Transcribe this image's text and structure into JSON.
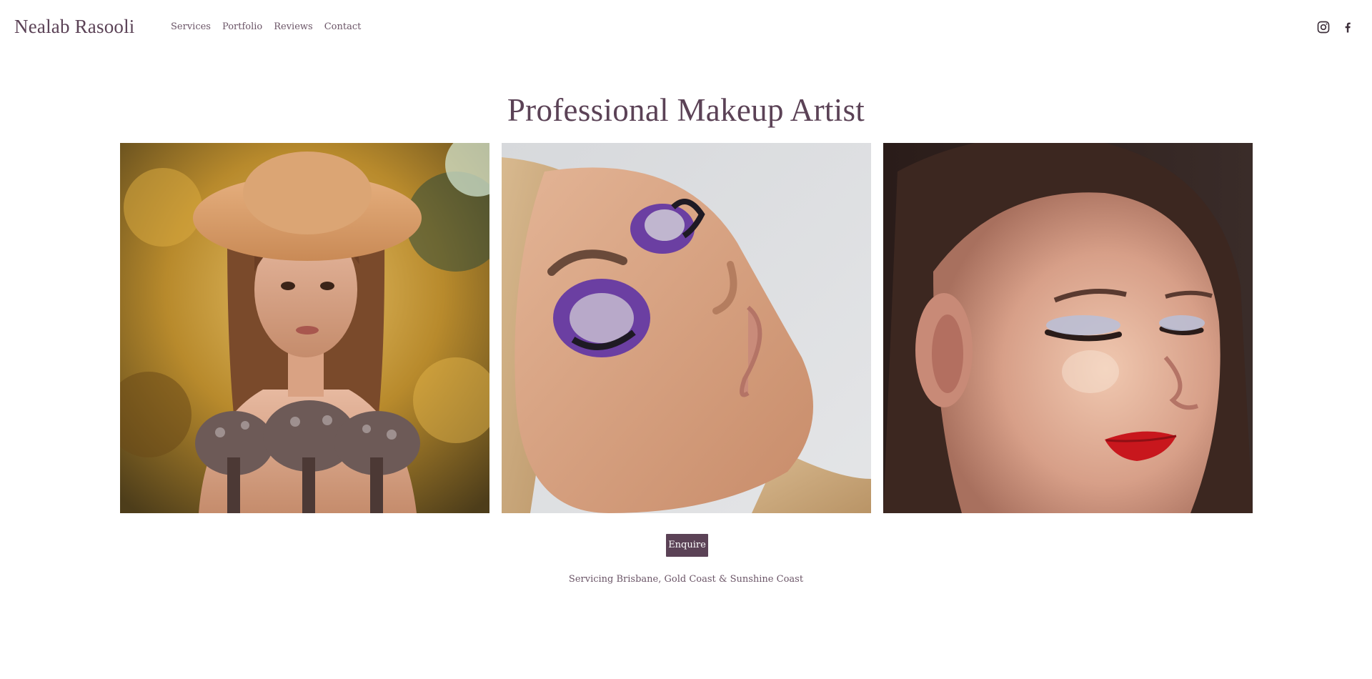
{
  "brand": {
    "name": "Nealab Rasooli"
  },
  "nav": {
    "items": [
      {
        "label": "Services"
      },
      {
        "label": "Portfolio"
      },
      {
        "label": "Reviews"
      },
      {
        "label": "Contact"
      }
    ]
  },
  "social": {
    "icons": [
      "instagram-icon",
      "facebook-icon"
    ]
  },
  "hero": {
    "title": "Professional Makeup Artist"
  },
  "gallery": {
    "photos": [
      {
        "subject": "woman-in-straw-hat-with-flowers"
      },
      {
        "subject": "purple-eyeshadow-close-up"
      },
      {
        "subject": "red-lip-glam-profile"
      }
    ]
  },
  "cta": {
    "enquire_label": "Enquire"
  },
  "footer": {
    "service_area": "Servicing Brisbane, Gold Coast & Sunshine Coast"
  },
  "colors": {
    "accent": "#5b4256",
    "text": "#6b5567",
    "background": "#ffffff"
  }
}
